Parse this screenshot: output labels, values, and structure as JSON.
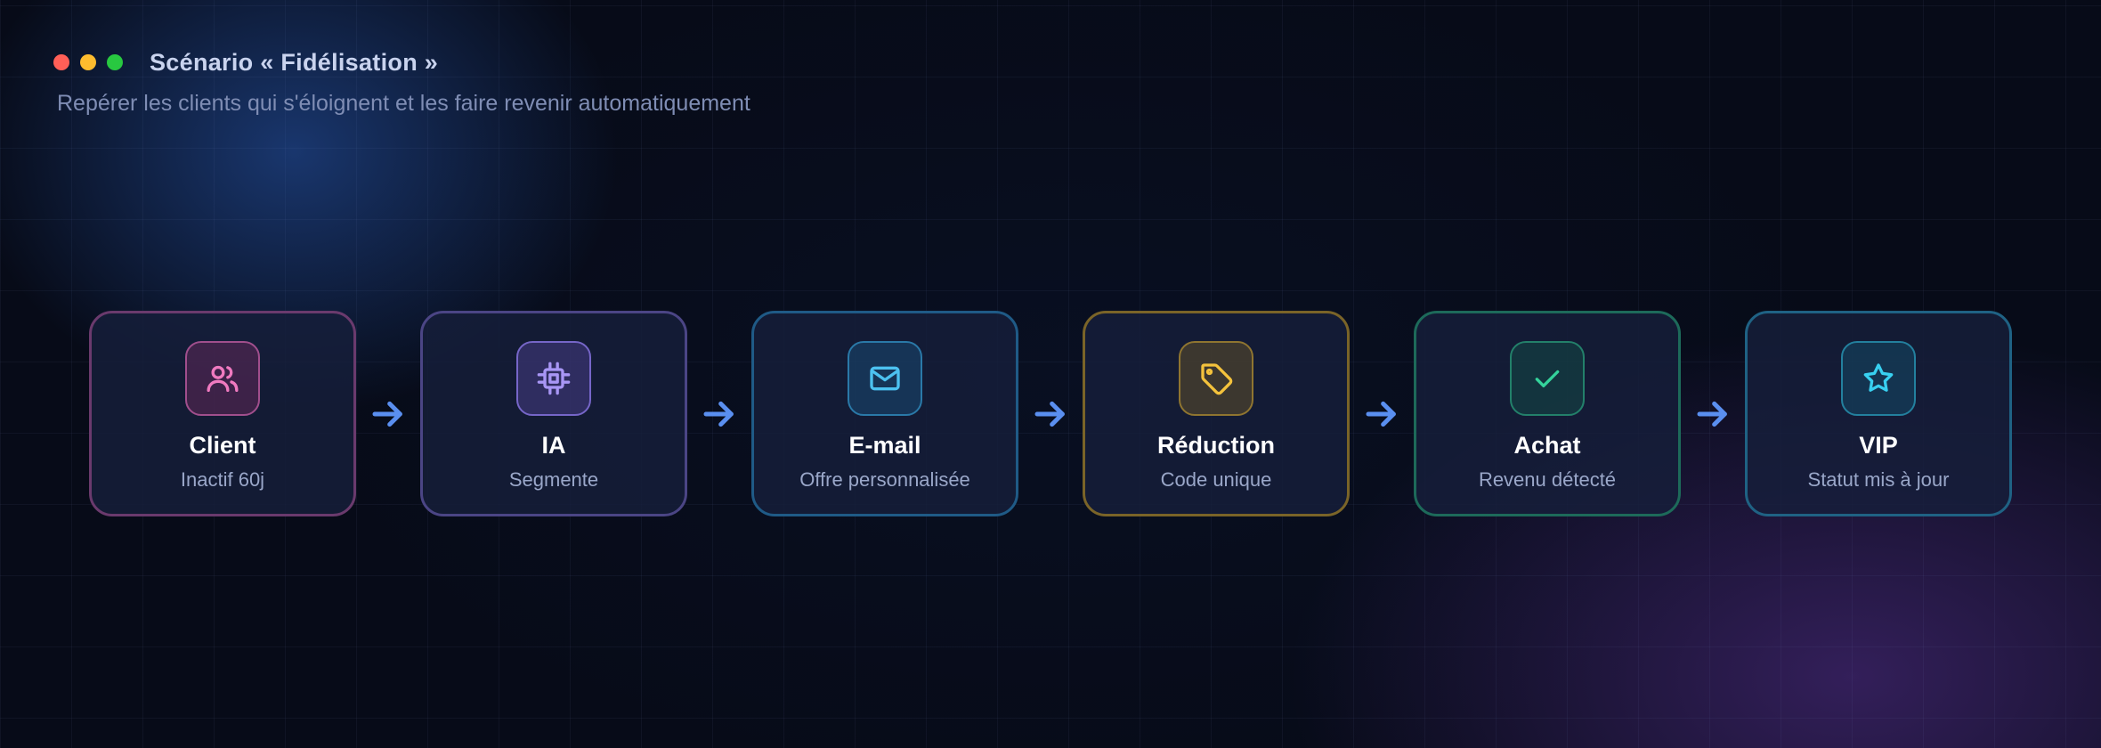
{
  "window": {
    "title": "Scénario « Fidélisation »",
    "subtitle": "Repérer les clients qui s'éloignent et les faire revenir automatiquement",
    "traffic_lights": [
      "#ff5f57",
      "#febc2e",
      "#28c840"
    ]
  },
  "steps": [
    {
      "title": "Client",
      "subtitle": "Inactif 60j",
      "icon": "users-icon",
      "color": "#f07ac0"
    },
    {
      "title": "IA",
      "subtitle": "Segmente",
      "icon": "cpu-chip-icon",
      "color": "#a896f5"
    },
    {
      "title": "E-mail",
      "subtitle": "Offre personnalisée",
      "icon": "mail-icon",
      "color": "#4cc1f0"
    },
    {
      "title": "Réduction",
      "subtitle": "Code unique",
      "icon": "tag-icon",
      "color": "#f4c23c"
    },
    {
      "title": "Achat",
      "subtitle": "Revenu détecté",
      "icon": "check-icon",
      "color": "#34d39b"
    },
    {
      "title": "VIP",
      "subtitle": "Statut mis à jour",
      "icon": "star-icon",
      "color": "#38d0f0"
    }
  ],
  "arrow_color": "#5a8ff0"
}
